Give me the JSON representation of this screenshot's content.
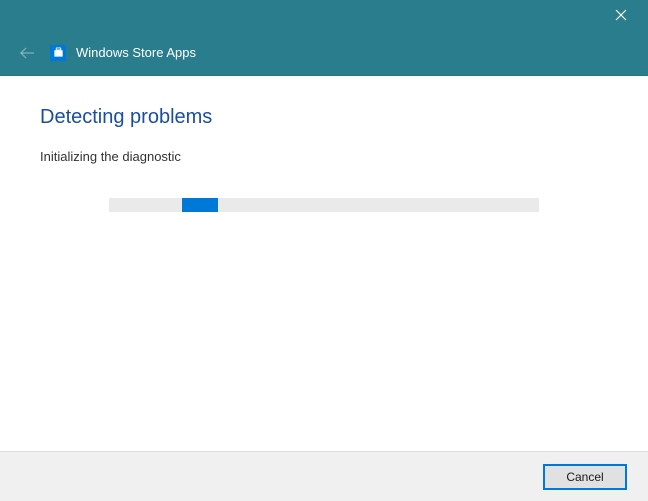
{
  "titlebar": {
    "close_label": "Close"
  },
  "header": {
    "title": "Windows Store Apps",
    "back_label": "Back"
  },
  "main": {
    "heading": "Detecting problems",
    "status": "Initializing the diagnostic",
    "progress_percent": 18
  },
  "footer": {
    "cancel_label": "Cancel"
  },
  "colors": {
    "accent": "#0078d7",
    "header_bg": "#2a7d8c",
    "heading_color": "#1a4ea0"
  },
  "icons": {
    "close": "close-icon",
    "back": "back-arrow-icon",
    "app": "store-icon"
  }
}
